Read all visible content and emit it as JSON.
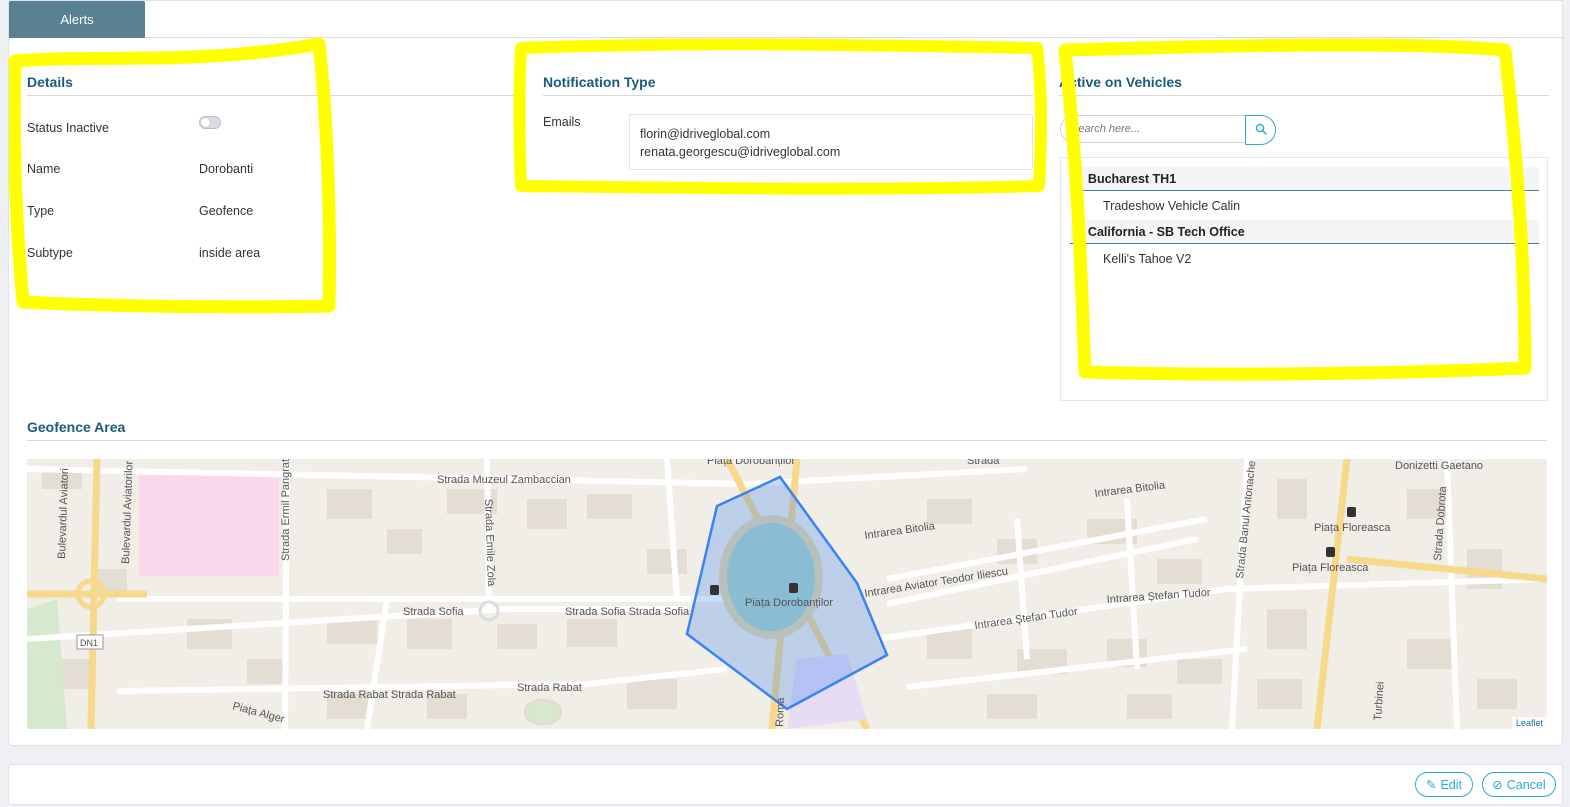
{
  "tabs": [
    {
      "label": "Alerts"
    }
  ],
  "details": {
    "title": "Details",
    "status_label": "Status Inactive",
    "status_active": false,
    "name_label": "Name",
    "name_value": "Dorobanti",
    "type_label": "Type",
    "type_value": "Geofence",
    "subtype_label": "Subtype",
    "subtype_value": "inside area"
  },
  "notification": {
    "title": "Notification Type",
    "emails_label": "Emails",
    "emails": [
      "florin@idriveglobal.com",
      "renata.georgescu@idriveglobal.com"
    ]
  },
  "vehicles": {
    "title": "Active on Vehicles",
    "search_placeholder": "Search here...",
    "groups": [
      {
        "name": "Bucharest TH1",
        "items": [
          "Tradeshow Vehicle Calin"
        ]
      },
      {
        "name": "California - SB Tech Office",
        "items": [
          "Kelli's Tahoe V2"
        ]
      }
    ]
  },
  "geofence": {
    "title": "Geofence Area",
    "attribution": "Leaflet",
    "map_labels": {
      "zambaccian": "Strada Muzeul Zambaccian",
      "bitolia_1": "Intrarea Bitolia",
      "bitolia_2": "Intrarea Bitolia",
      "aviator": "Intrarea Aviator Teodor Iliescu",
      "stefan_tudor_1": "Intrarea Ștefan Tudor",
      "stefan_tudor_2": "Intrarea Ștefan Tudor",
      "sofia_1": "Strada Sofia",
      "sofia_2": "Strada Sofia Strada Sofia",
      "rabat_1": "Strada Rabat  Strada Rabat",
      "rabat_2": "Strada Rabat",
      "alger": "Piața Alger",
      "piata_dorobantilor": "Piața Dorobanților",
      "piata_dorobantilor_top": "Piața Dorobanților",
      "floreasca_1": "Piața Floreasca",
      "floreasca_2": "Piața Floreasca",
      "aviatorilor": "Bulevardul Aviatori",
      "bulevardul_aviatorilor": "Bulevardul Aviatorilor",
      "ermil": "Strada Ermil Pangrat",
      "emile_zola": "Strada Emile Zola",
      "banul": "Strada Banul Antonache",
      "dobrota": "Strada Dobrota",
      "turbinei": "Turbinei",
      "roma": "Roma",
      "strada_top": "Strada",
      "donizetti": "Donizetti Gaetano",
      "dn1": "DN1"
    }
  },
  "actions": {
    "edit_label": "Edit",
    "cancel_label": "Cancel"
  },
  "colors": {
    "accent": "#2ba8d8",
    "heading": "#1b5c7e",
    "tab": "#5a8192",
    "geofence": "#3b82f6",
    "highlight": "#ffff00"
  }
}
